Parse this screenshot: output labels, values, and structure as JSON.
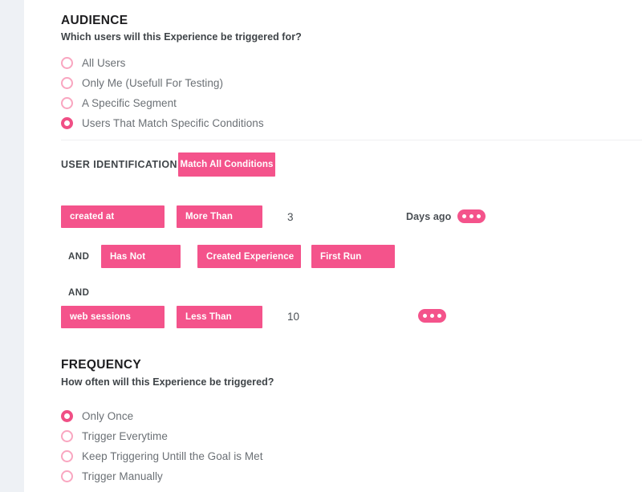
{
  "audience": {
    "title": "AUDIENCE",
    "question": "Which users will this Experience be triggered for?",
    "options": [
      {
        "label": "All Users",
        "selected": false
      },
      {
        "label": "Only Me (Usefull For Testing)",
        "selected": false
      },
      {
        "label": "A Specific Segment",
        "selected": false
      },
      {
        "label": "Users That Match Specific Conditions",
        "selected": true
      }
    ]
  },
  "user_identification": {
    "title": "USER IDENTIFICATION",
    "match_button_label": "Match All Conditions",
    "conditions": [
      {
        "connector": "",
        "attribute": "created at",
        "operator": "More Than",
        "value": "3",
        "unit": "Days ago",
        "menu_icon": "ellipsis-icon"
      },
      {
        "connector": "AND",
        "verb": "Has Not",
        "action": "Created Experience",
        "target": "First Run"
      },
      {
        "connector": "AND",
        "attribute": "web sessions",
        "operator": "Less Than",
        "value": "10",
        "unit": "",
        "menu_icon": "ellipsis-icon"
      }
    ]
  },
  "frequency": {
    "title": "FREQUENCY",
    "question": "How often will this Experience be triggered?",
    "options": [
      {
        "label": "Only Once",
        "selected": true
      },
      {
        "label": "Trigger Everytime",
        "selected": false
      },
      {
        "label": "Keep Triggering Untill the Goal is Met",
        "selected": false
      },
      {
        "label": "Trigger Manually",
        "selected": false
      }
    ]
  },
  "colors": {
    "accent": "#f4538b",
    "accent_light": "#f9a6c0",
    "rail": "#eef1f5",
    "divider": "#efeff1"
  }
}
